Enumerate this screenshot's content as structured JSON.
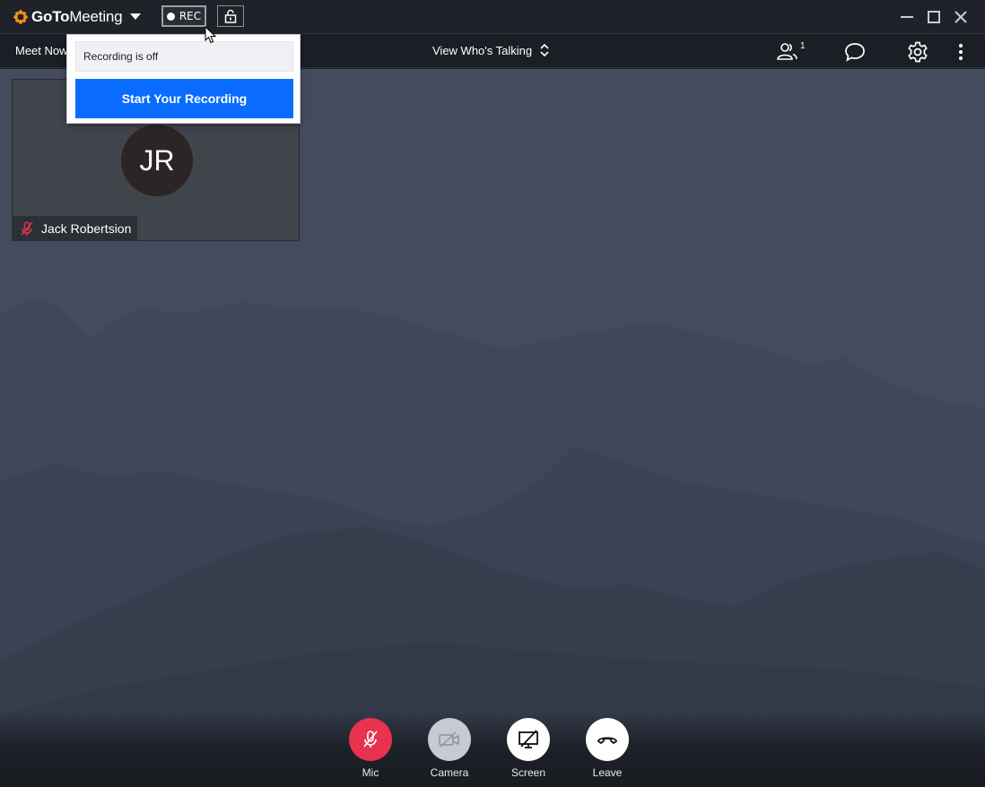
{
  "app": {
    "brand_bold": "GoTo",
    "brand_light": "Meeting",
    "accent_color": "#f7941d"
  },
  "titlebar": {
    "rec_label": "REC"
  },
  "toolbar": {
    "meet_now_label": "Meet Now",
    "view_mode_label": "View Who's Talking",
    "attendee_count": "1"
  },
  "recording_popover": {
    "status_text": "Recording is off",
    "button_label": "Start Your Recording",
    "button_color": "#0a6cff"
  },
  "participant": {
    "initials": "JR",
    "name": "Jack Robertsion",
    "muted": true
  },
  "controls": {
    "mic_label": "Mic",
    "camera_label": "Camera",
    "screen_label": "Screen",
    "leave_label": "Leave",
    "mic_color": "#e8324e"
  }
}
